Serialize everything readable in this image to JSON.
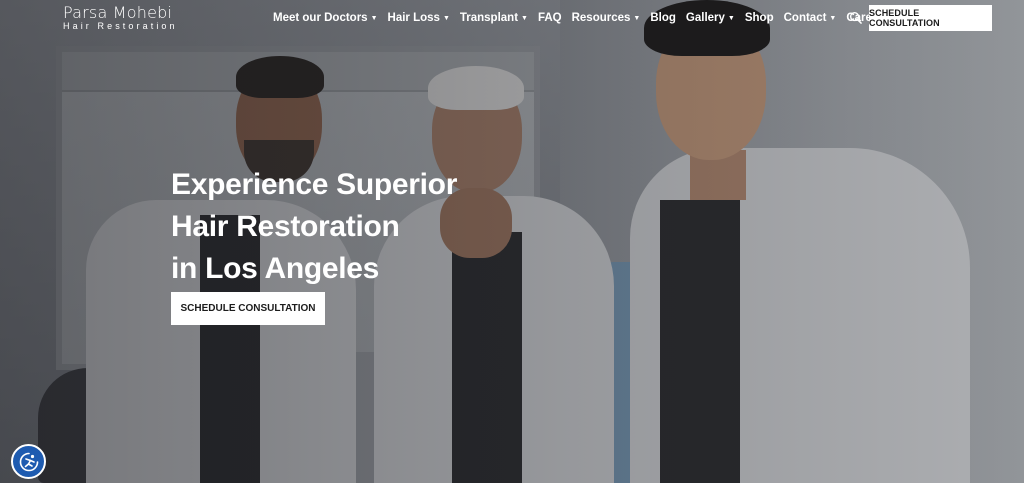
{
  "logo": {
    "name": "Parsa Mohebi",
    "tagline": "Hair Restoration"
  },
  "nav": {
    "items": [
      {
        "label": "Meet our Doctors",
        "dropdown": true
      },
      {
        "label": "Hair Loss",
        "dropdown": true
      },
      {
        "label": "Transplant",
        "dropdown": true
      },
      {
        "label": "FAQ",
        "dropdown": false
      },
      {
        "label": "Resources",
        "dropdown": true
      },
      {
        "label": "Blog",
        "dropdown": false
      },
      {
        "label": "Gallery",
        "dropdown": true
      },
      {
        "label": "Shop",
        "dropdown": false
      },
      {
        "label": "Contact",
        "dropdown": true
      },
      {
        "label": "Careers",
        "dropdown": false
      }
    ],
    "caret": "▼",
    "search_icon": "search-icon",
    "cta_label": "SCHEDULE CONSULTATION"
  },
  "hero": {
    "headline": [
      "Experience Superior",
      "Hair Restoration",
      "in Los Angeles"
    ],
    "cta_label": "SCHEDULE CONSULTATION"
  },
  "accessibility": {
    "icon": "accessibility-icon"
  },
  "colors": {
    "nav_text": "#ffffff",
    "button_bg": "#ffffff",
    "button_text": "#1c1c1c",
    "accessibility_bg": "#1e5bb0"
  }
}
